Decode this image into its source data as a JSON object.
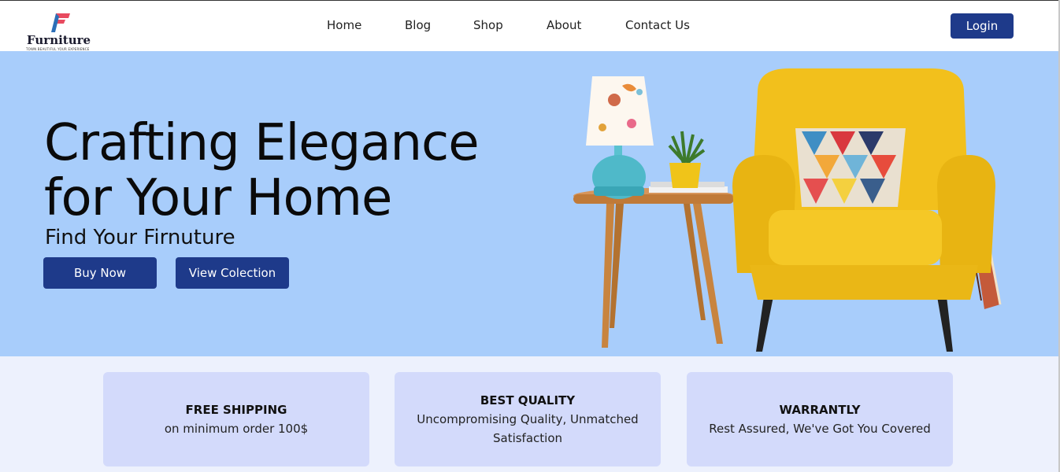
{
  "brand": {
    "name": "Furniture",
    "tagline": "TOWN BEAUTIFUL YOUR EXPERIENCE",
    "mark_colors": [
      "#e84a5f",
      "#2c6fb7"
    ]
  },
  "nav": {
    "items": [
      {
        "label": "Home"
      },
      {
        "label": "Blog"
      },
      {
        "label": "Shop"
      },
      {
        "label": "About"
      },
      {
        "label": "Contact Us"
      }
    ],
    "login_label": "Login"
  },
  "hero": {
    "title_line1": "Crafting Elegance",
    "title_line2": "for Your Home",
    "subtitle": "Find Your Firnuture",
    "buy_label": "Buy Now",
    "view_label": "View Colection",
    "image_icon": "armchair-side-table-lamp"
  },
  "features": [
    {
      "title": "FREE SHIPPING",
      "desc": "on minimum order 100$"
    },
    {
      "title": "BEST QUALITY",
      "desc": "Uncompromising Quality, Unmatched Satisfaction"
    },
    {
      "title": "WARRANTLY",
      "desc": "Rest Assured, We've Got You Covered"
    }
  ],
  "colors": {
    "primary": "#1e3a8a",
    "hero_bg": "#a8cdfb",
    "features_bg": "#edf1fd",
    "card_bg": "#d3dafb",
    "chair": "#f2c01c"
  }
}
